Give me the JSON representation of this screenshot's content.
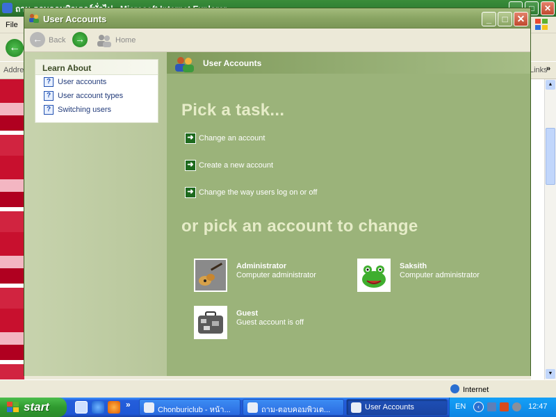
{
  "bg_window": {
    "title": "ถาม-ตอบคอมพิวเตอร์ทั่วไป - Microsoft Internet Explorer",
    "menu": [
      "File"
    ],
    "address_label": "Address",
    "links_label": "Links",
    "status_zone": "Internet"
  },
  "window": {
    "title": "User Accounts",
    "buttons": {
      "minimize": "_",
      "maximize": "□",
      "close": "✕"
    }
  },
  "nav": {
    "back": "Back",
    "home": "Home"
  },
  "learn_about": {
    "heading": "Learn About",
    "items": [
      "User accounts",
      "User account types",
      "Switching users"
    ]
  },
  "main": {
    "header": "User Accounts",
    "pick_task": "Pick a task...",
    "tasks": [
      "Change an account",
      "Create a new account",
      "Change the way users log on or off"
    ],
    "pick_account": "or pick an account to change",
    "accounts": [
      {
        "name": "Administrator",
        "type": "Computer administrator",
        "picture": "guitar"
      },
      {
        "name": "Saksith",
        "type": "Computer administrator",
        "picture": "frog"
      },
      {
        "name": "Guest",
        "type": "Guest account is off",
        "picture": "suitcase"
      }
    ]
  },
  "taskbar": {
    "start": "start",
    "quick_launch_chevron": "»",
    "tasks": [
      {
        "label": "Chonburiclub - หน้า...",
        "active": false
      },
      {
        "label": "ถาม-ตอบคอมพิวเต...",
        "active": false
      },
      {
        "label": "User Accounts",
        "active": true
      }
    ],
    "language": "EN",
    "clock": "12:47"
  },
  "colors": {
    "ua_background": "#9bb37a",
    "ua_left_pane": "#c7d3ad",
    "taskbar_blue": "#245edb",
    "start_green": "#2f9a2f"
  }
}
